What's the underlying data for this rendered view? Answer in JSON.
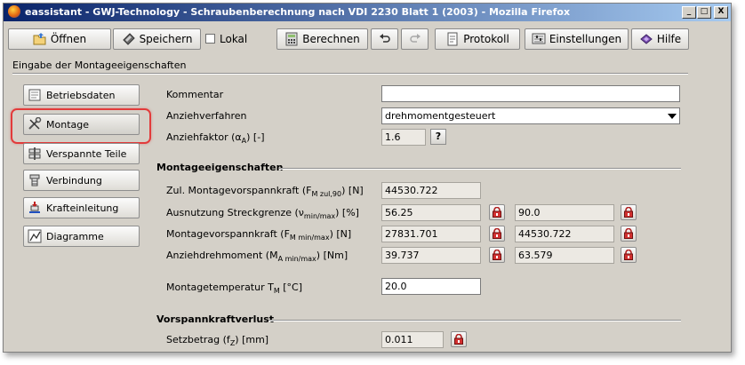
{
  "window": {
    "title": "eassistant - GWJ-Technology - Schraubenberechnung nach VDI 2230 Blatt 1 (2003) - Mozilla Firefox",
    "controls": {
      "minimize": "_",
      "maximize": "□",
      "close": "X"
    }
  },
  "toolbar": {
    "open": "Öffnen",
    "save": "Speichern",
    "local": "Lokal",
    "local_checked": false,
    "calculate": "Berechnen",
    "protocol": "Protokoll",
    "settings": "Einstellungen",
    "help": "Hilfe"
  },
  "section_title": "Eingabe der Montageeigenschaften",
  "nav": [
    {
      "label": "Betriebsdaten",
      "icon": "document-icon"
    },
    {
      "label": "Montage",
      "icon": "wrench-screwdriver-icon",
      "selected": true
    },
    {
      "label": "Verspannte Teile",
      "icon": "parts-icon"
    },
    {
      "label": "Verbindung",
      "icon": "bolt-connection-icon"
    },
    {
      "label": "Krafteinleitung",
      "icon": "force-icon"
    },
    {
      "label": "Diagramme",
      "icon": "chart-icon"
    }
  ],
  "form": {
    "kommentar": {
      "label": "Kommentar",
      "value": ""
    },
    "anziehverfahren": {
      "label": "Anziehverfahren",
      "value": "drehmomentgesteuert"
    },
    "anziehfaktor": {
      "label_main": "Anziehfaktor (α",
      "label_sub": "A",
      "label_end": ") [-]",
      "value": "1.6",
      "help": "?"
    }
  },
  "montage": {
    "heading": "Montageeigenschaften",
    "zul": {
      "label_main": "Zul. Montagevorspannkraft (F",
      "label_sub": "M zul,90",
      "label_end": ") [N]",
      "value": "44530.722"
    },
    "ausnutzung": {
      "label_main": "Ausnutzung Streckgrenze (ν",
      "label_sub": "min/max",
      "label_end": ") [%]",
      "min": "56.25",
      "max": "90.0"
    },
    "vorspannkraft": {
      "label_main": "Montagevorspannkraft (F",
      "label_sub": "M min/max",
      "label_end": ") [N]",
      "min": "27831.701",
      "max": "44530.722"
    },
    "drehmoment": {
      "label_main": "Anziehdrehmoment (M",
      "label_sub": "A min/max",
      "label_end": ") [Nm]",
      "min": "39.737",
      "max": "63.579"
    },
    "temperatur": {
      "label_main": "Montagetemperatur T",
      "label_sub": "M",
      "label_end": " [°C]",
      "value": "20.0"
    }
  },
  "verlust": {
    "heading": "Vorspannkraftverlust",
    "setzbetrag": {
      "label_main": "Setzbetrag (f",
      "label_sub": "Z",
      "label_end": ") [mm]",
      "value": "0.011"
    }
  }
}
